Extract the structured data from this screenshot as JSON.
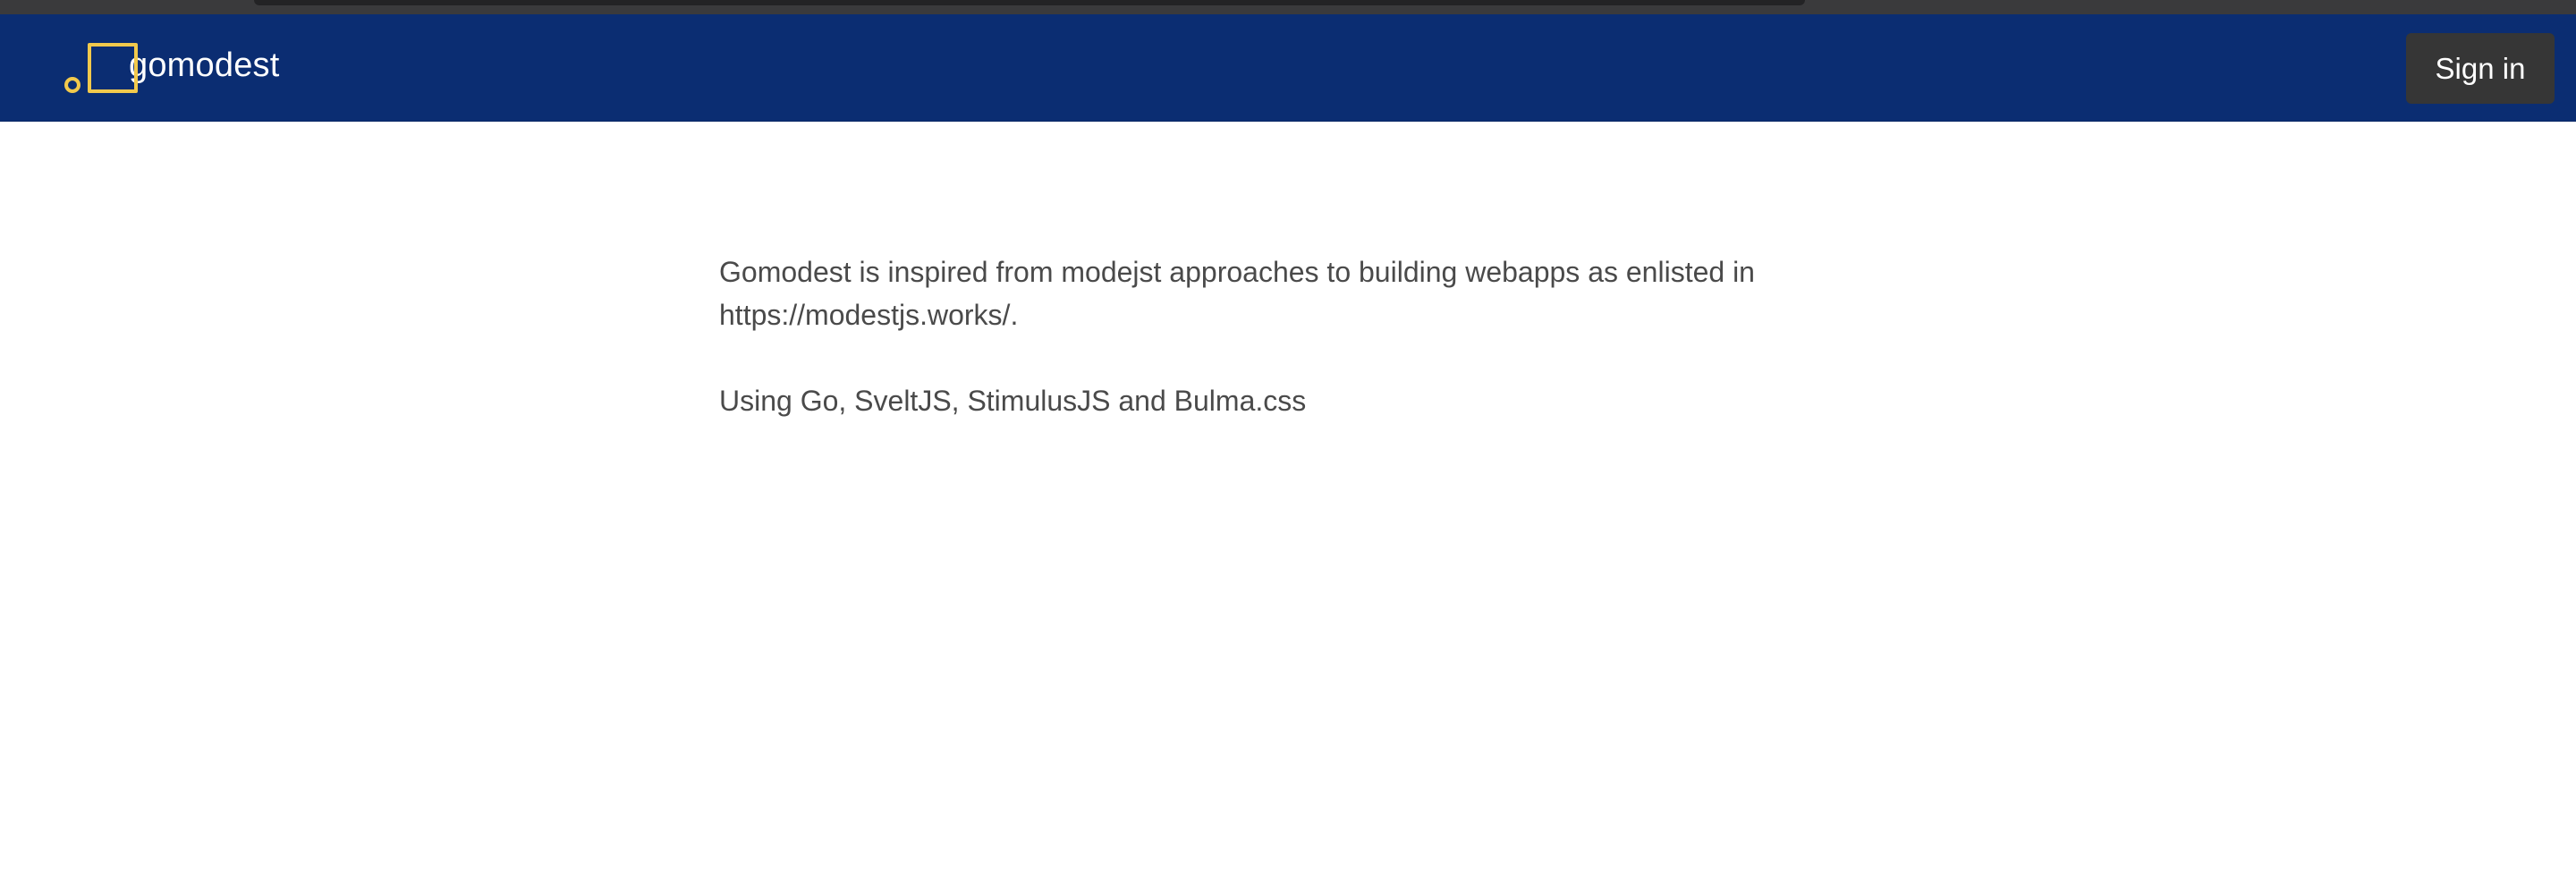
{
  "navbar": {
    "brand_name": "gomodest",
    "signin_label": "Sign in",
    "logo_icon": "gomodest-logo-icon",
    "background_color": "#0b2d72",
    "logo_color": "#f2c94c"
  },
  "main": {
    "intro_text": "Gomodest is inspired from modejst approaches to building webapps as enlisted in https://modestjs.works/.",
    "stack_text": "Using Go, SveltJS, StimulusJS and Bulma.css"
  }
}
